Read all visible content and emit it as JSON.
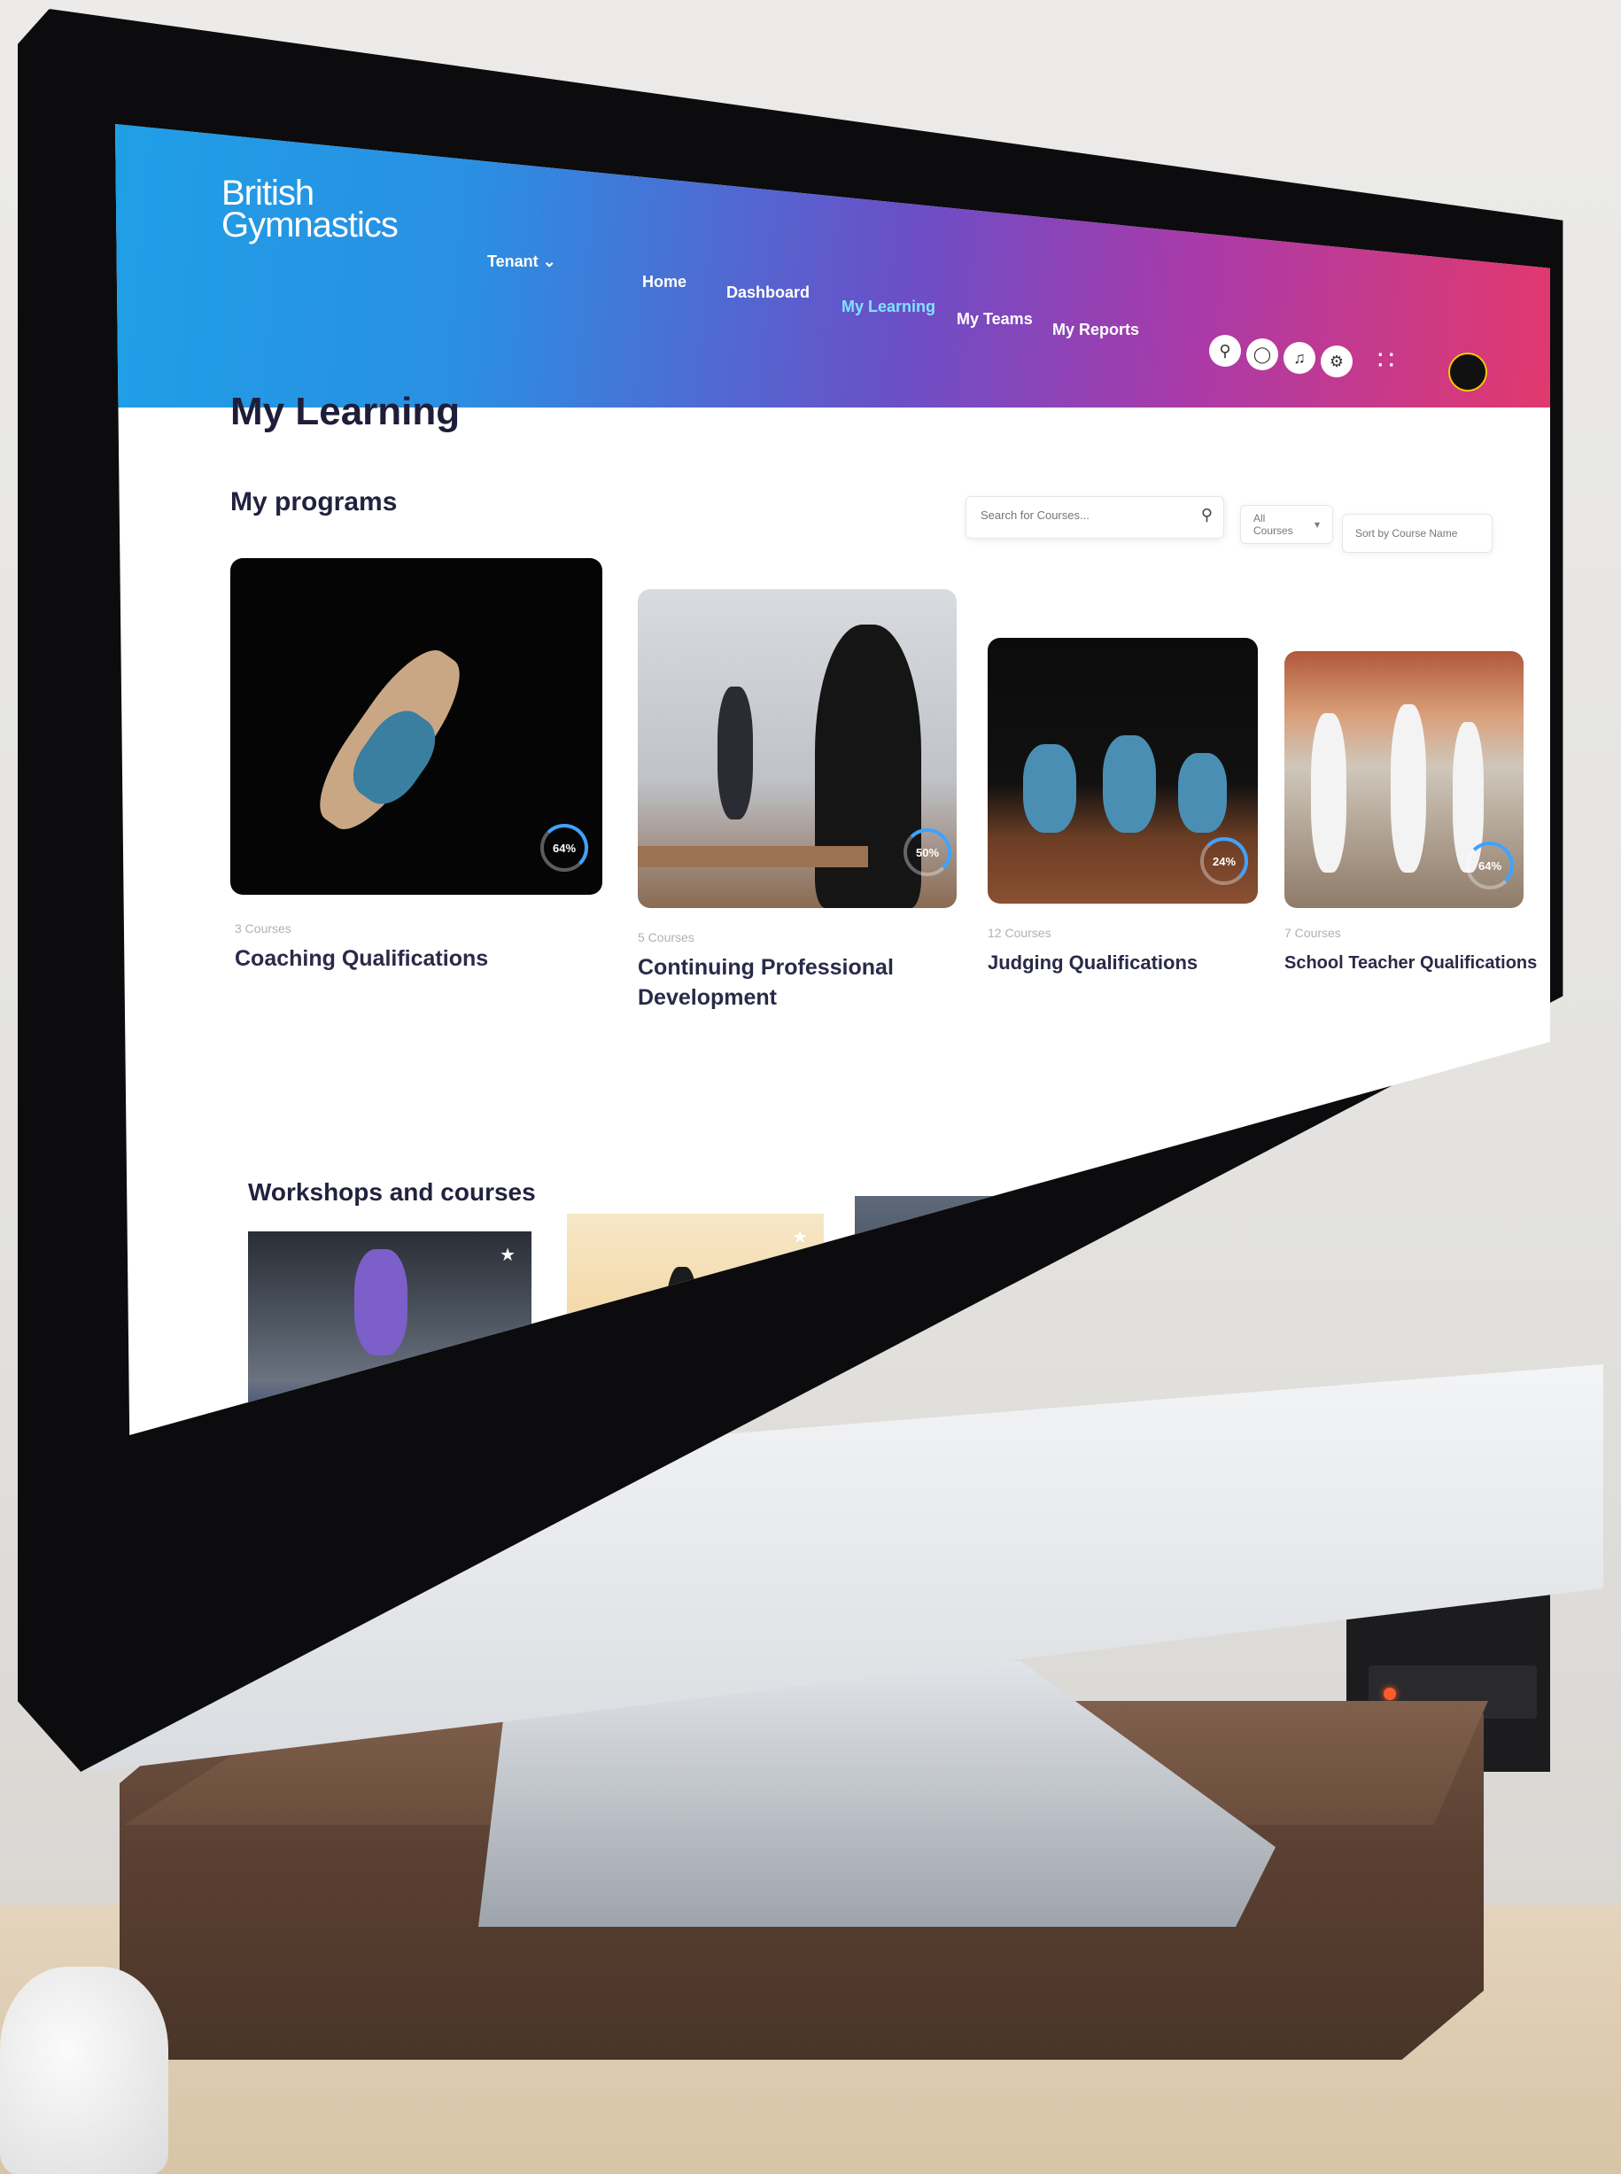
{
  "header": {
    "logo_line1": "British",
    "logo_line2": "Gymnastics",
    "tenant": "Tenant ⌄",
    "nav": [
      "Home",
      "Dashboard",
      "My Learning",
      "My Teams",
      "My Reports"
    ],
    "active_nav": "My Learning"
  },
  "page": {
    "title": "My Learning",
    "programs_title": "My programs",
    "workshops_title": "Workshops and courses"
  },
  "search": {
    "placeholder": "Search for Courses..."
  },
  "filters": {
    "all_courses": "All Courses",
    "sort": "Sort by Course Name"
  },
  "programs": [
    {
      "count": "3 Courses",
      "title": "Coaching Qualifications",
      "progress": "64%"
    },
    {
      "count": "5 Courses",
      "title": "Continuing Professional Development",
      "progress": "50%"
    },
    {
      "count": "12 Courses",
      "title": "Judging Qualifications",
      "progress": "24%"
    },
    {
      "count": "7 Courses",
      "title": "School Teacher Qualifications",
      "progress": "64%"
    }
  ],
  "colors": {
    "brand_blue": "#1f9fe6",
    "brand_pink": "#e2396e",
    "active_nav": "#7fe3ff",
    "progress_ring": "#3fa2ff"
  },
  "icons": [
    "search-icon",
    "chat-icon",
    "bell-icon",
    "gear-icon",
    "apps-grid-icon",
    "star-icon"
  ]
}
